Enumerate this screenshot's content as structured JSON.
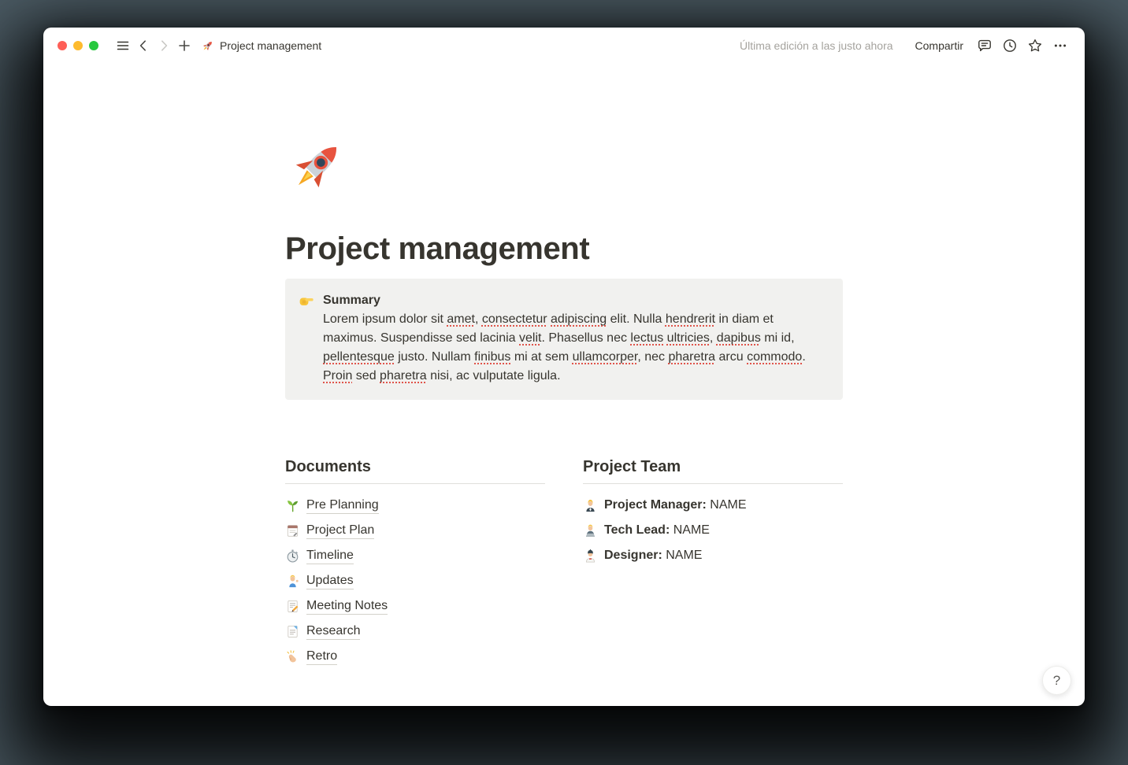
{
  "titlebar": {
    "window_controls": [
      {
        "name": "close-button",
        "color": "#fe5f57"
      },
      {
        "name": "minimize-button",
        "color": "#febb2e"
      },
      {
        "name": "zoom-button",
        "color": "#28c83f"
      }
    ],
    "title": "Project management",
    "title_icon": "rocket-icon",
    "title_emoji": "🚀",
    "last_edited": "Última edición a las justo ahora",
    "share": "Compartir"
  },
  "page": {
    "icon": "rocket-icon",
    "icon_emoji": "🚀",
    "title": "Project management",
    "callout": {
      "icon": "pointing-right-icon",
      "icon_emoji": "👉",
      "heading": "Summary",
      "segments": [
        {
          "t": "Lorem ipsum dolor sit "
        },
        {
          "t": "amet",
          "sp": true
        },
        {
          "t": ", "
        },
        {
          "t": "consectetur",
          "sp": true
        },
        {
          "t": " "
        },
        {
          "t": "adipiscing",
          "sp": true
        },
        {
          "t": " elit. Nulla "
        },
        {
          "t": "hendrerit",
          "sp": true
        },
        {
          "t": " in diam et maximus. Suspendisse sed lacinia "
        },
        {
          "t": "velit",
          "sp": true
        },
        {
          "t": ". Phasellus nec "
        },
        {
          "t": "lectus",
          "sp": true
        },
        {
          "t": " "
        },
        {
          "t": "ultricies",
          "sp": true
        },
        {
          "t": ", "
        },
        {
          "t": "dapibus",
          "sp": true
        },
        {
          "t": " mi id, "
        },
        {
          "t": "pellentesque",
          "sp": true
        },
        {
          "t": " justo. Nullam "
        },
        {
          "t": "finibus",
          "sp": true
        },
        {
          "t": " mi at sem "
        },
        {
          "t": "ullamcorper",
          "sp": true
        },
        {
          "t": ", nec "
        },
        {
          "t": "pharetra",
          "sp": true
        },
        {
          "t": " arcu "
        },
        {
          "t": "commodo",
          "sp": true
        },
        {
          "t": ". "
        },
        {
          "t": "Proin",
          "sp": true
        },
        {
          "t": " sed "
        },
        {
          "t": "pharetra",
          "sp": true
        },
        {
          "t": " nisi, ac vulputate ligula."
        }
      ]
    },
    "documents": {
      "heading": "Documents",
      "items": [
        {
          "icon": "seedling-icon",
          "emoji": "🌱",
          "label": "Pre Planning"
        },
        {
          "icon": "notepad-icon",
          "emoji": "🗒️",
          "label": "Project Plan"
        },
        {
          "icon": "stopwatch-icon",
          "emoji": "⏱️",
          "label": "Timeline"
        },
        {
          "icon": "person-tipping-hand-icon",
          "emoji": "💁🏼‍♀️",
          "label": "Updates"
        },
        {
          "icon": "memo-icon",
          "emoji": "📝",
          "label": "Meeting Notes"
        },
        {
          "icon": "bookmark-tabs-icon",
          "emoji": "📑",
          "label": "Research"
        },
        {
          "icon": "clapping-hands-icon",
          "emoji": "👏",
          "label": "Retro"
        }
      ]
    },
    "team": {
      "heading": "Project Team",
      "members": [
        {
          "icon": "woman-office-worker-icon",
          "emoji": "👩🏼‍💼",
          "role": "Project Manager:",
          "name": "NAME"
        },
        {
          "icon": "technologist-icon",
          "emoji": "👨🏼‍💻",
          "role": "Tech Lead:",
          "name": "NAME"
        },
        {
          "icon": "artist-icon",
          "emoji": "👨🏼‍🎨",
          "role": "Designer:",
          "name": "NAME"
        }
      ]
    }
  },
  "help": {
    "label": "?"
  },
  "colors": {
    "text": "#37352f",
    "muted_text": "#a5a39e",
    "callout_bg": "#f1f1ef",
    "divider": "#e0dfdc",
    "link_underline": "#d3d1ca",
    "misspell_underline": "#e0544a",
    "traffic_red": "#fe5f57",
    "traffic_yellow": "#febb2e",
    "traffic_green": "#28c83f",
    "backdrop": "#4e5e67"
  }
}
